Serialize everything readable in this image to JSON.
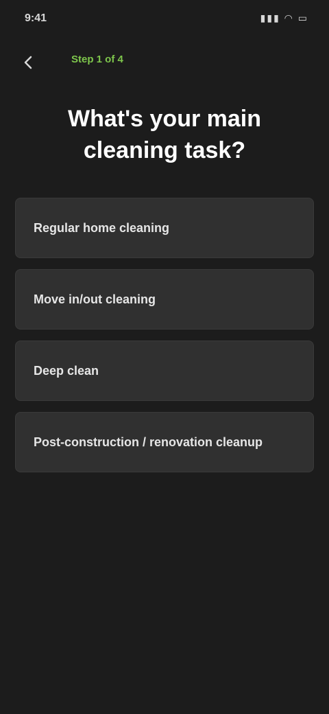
{
  "status_bar": {
    "time": "9:41",
    "icons_text": "▮▮▮ ◠ ▭"
  },
  "nav": {
    "back_icon": "arrow-left-icon",
    "step_label": "Step 1 of 4"
  },
  "question": {
    "title": "What's your main cleaning task?"
  },
  "options": [
    {
      "label": "Regular home cleaning"
    },
    {
      "label": "Move in/out cleaning"
    },
    {
      "label": "Deep clean"
    },
    {
      "label": "Post-construction / renovation cleanup"
    }
  ],
  "colors": {
    "background": "#1c1c1c",
    "card": "#303030",
    "accent": "#7ec64c",
    "text": "#ffffff"
  }
}
